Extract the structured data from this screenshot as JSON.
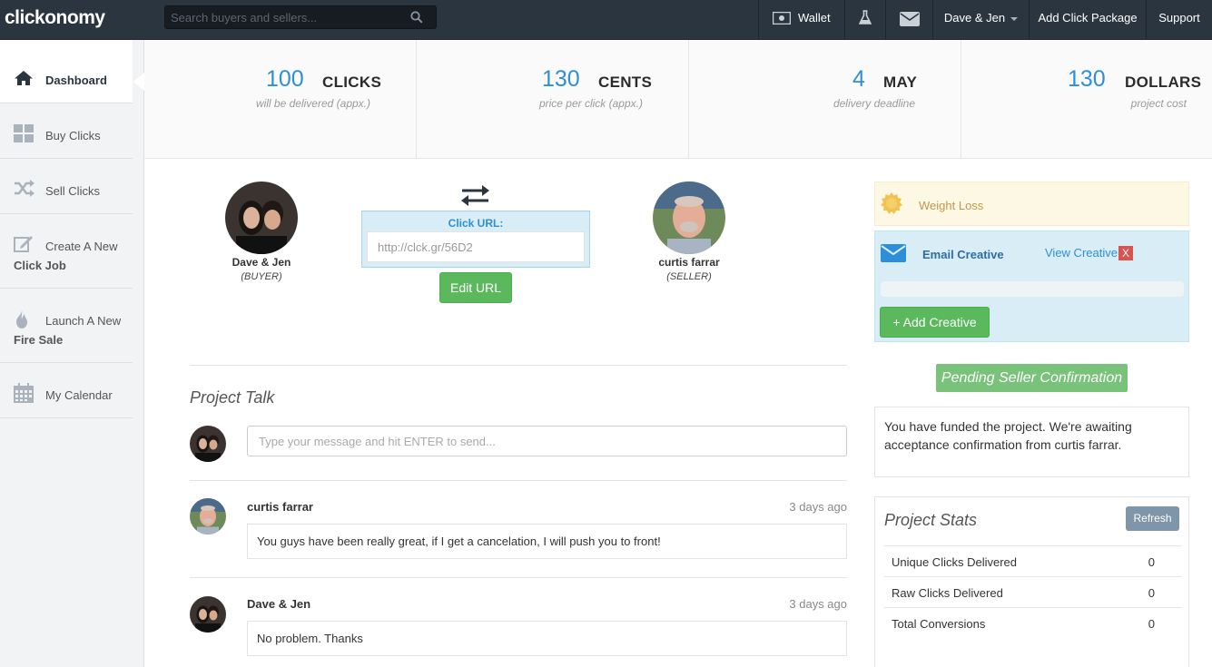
{
  "app": {
    "logo": "clickonomy"
  },
  "search": {
    "placeholder": "Search buyers and sellers..."
  },
  "topnav": {
    "wallet": "Wallet",
    "user": "Dave & Jen",
    "add_package": "Add Click Package",
    "support": "Support"
  },
  "sidebar": {
    "items": [
      {
        "label": "Dashboard",
        "icon": "home-icon"
      },
      {
        "label": "Buy Clicks",
        "icon": "grid-icon"
      },
      {
        "label": "Sell Clicks",
        "icon": "shuffle-icon"
      },
      {
        "label": "Create A New",
        "label2": "Click Job",
        "icon": "edit-icon"
      },
      {
        "label": "Launch A New",
        "label2": "Fire Sale",
        "icon": "fire-icon"
      },
      {
        "label": "My Calendar",
        "icon": "calendar-icon"
      }
    ]
  },
  "stats": [
    {
      "num": "100",
      "unit": "CLICKS",
      "sub": "will be delivered (appx.)"
    },
    {
      "num": "130",
      "unit": "CENTS",
      "sub": "price per click (appx.)"
    },
    {
      "num": "4",
      "unit": "MAY",
      "sub": "delivery deadline"
    },
    {
      "num": "130",
      "unit": "DOLLARS",
      "sub": "project cost"
    }
  ],
  "buyer": {
    "name": "Dave & Jen",
    "role": "BUYER"
  },
  "seller": {
    "name": "curtis farrar",
    "role": "SELLER"
  },
  "click_url": {
    "label": "Click URL:",
    "value": "http://clck.gr/56D2",
    "edit_label": "Edit URL"
  },
  "talk": {
    "title": "Project Talk",
    "placeholder": "Type your message and hit ENTER to send...",
    "messages": [
      {
        "author": "curtis farrar",
        "time": "3 days ago",
        "text": "You guys have been really great, if I get a cancelation, I will push you to front!"
      },
      {
        "author": "Dave & Jen",
        "time": "3 days ago",
        "text": "No problem. Thanks"
      }
    ]
  },
  "category": {
    "label": "Weight Loss"
  },
  "creative": {
    "label": "Email Creative",
    "view_label": "View Creative",
    "remove_label": "X",
    "add_label": "+ Add Creative"
  },
  "status": {
    "label": "Pending Seller Confirmation"
  },
  "notice": {
    "text": "You have funded the project. We're awaiting acceptance confirmation from curtis farrar."
  },
  "project_stats": {
    "title": "Project Stats",
    "refresh_label": "Refresh",
    "rows": [
      {
        "label": "Unique Clicks Delivered",
        "value": "0"
      },
      {
        "label": "Raw Clicks Delivered",
        "value": "0"
      },
      {
        "label": "Total Conversions",
        "value": "0"
      }
    ]
  },
  "colors": {
    "accent": "#2e8fd8",
    "success": "#5cb85c",
    "topbar": "#2b3540"
  }
}
